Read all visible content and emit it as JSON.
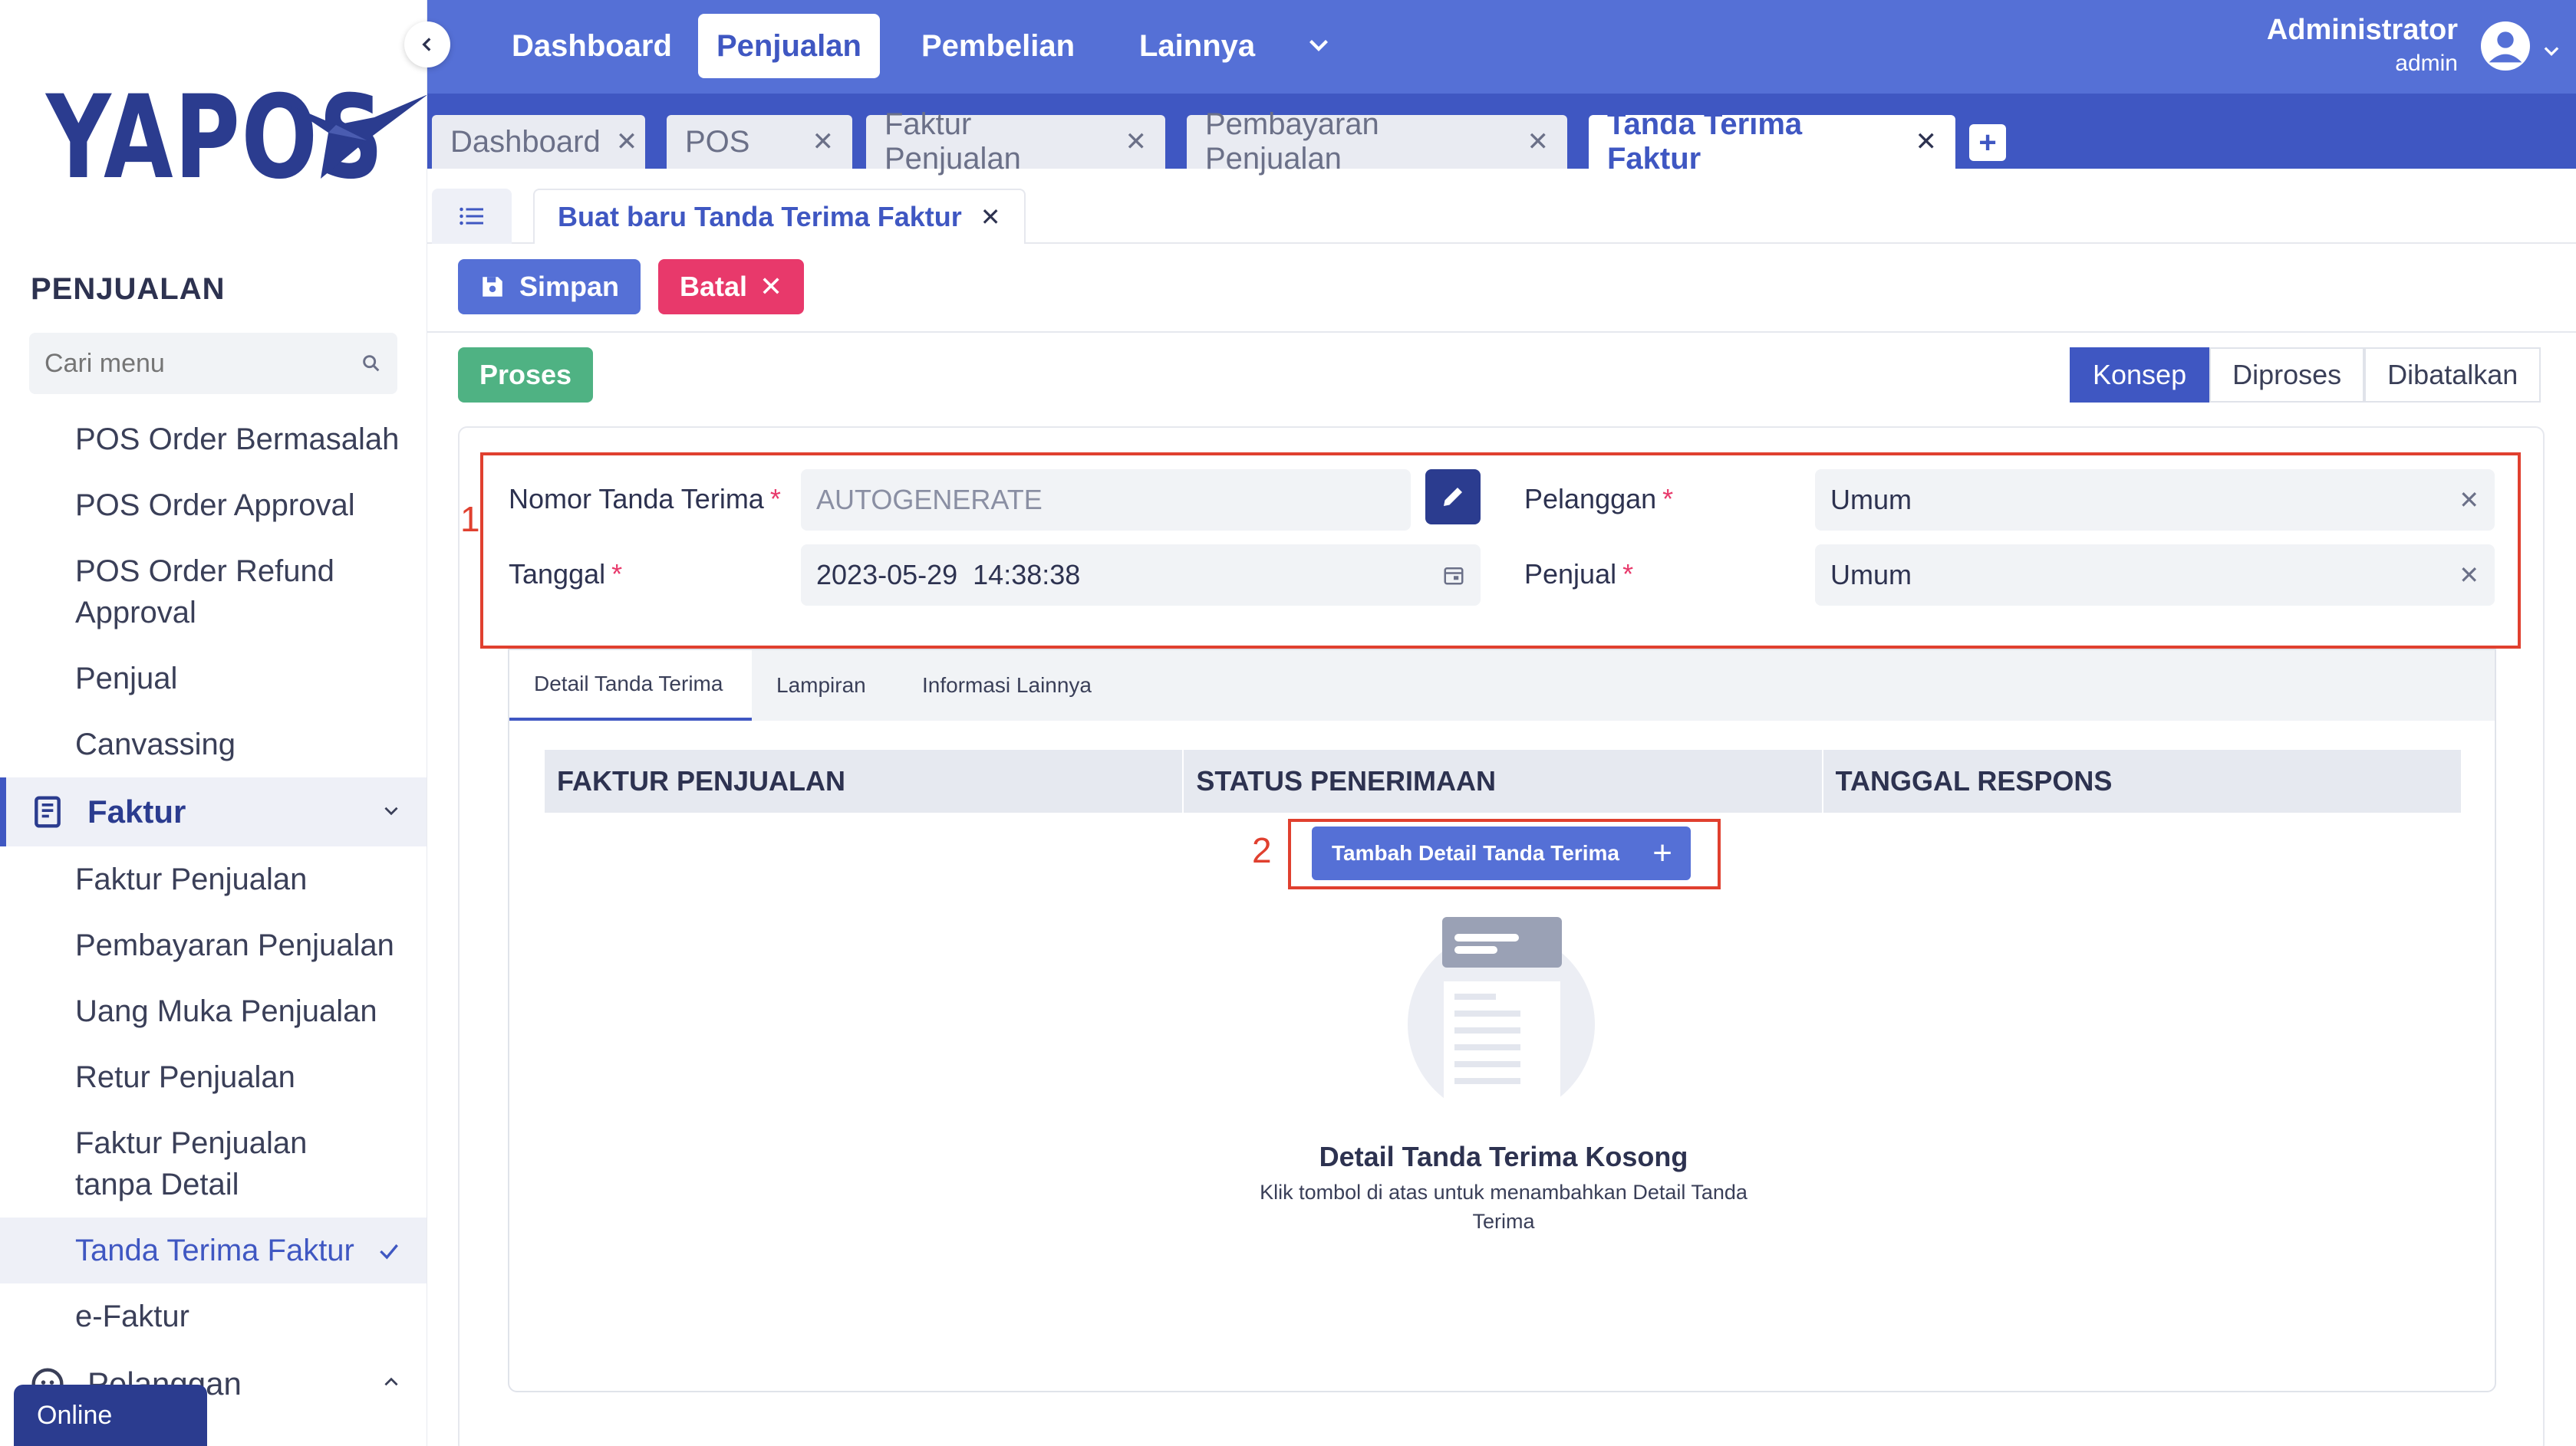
{
  "brand": {
    "name": "YAPOS"
  },
  "colors": {
    "primary": "#3f57c2",
    "nav": "#5570d6",
    "danger": "#e8396b",
    "success": "#4fb283",
    "annotation": "#e0402f"
  },
  "sidebar": {
    "section_title": "PENJUALAN",
    "search_placeholder": "Cari menu",
    "items_top": [
      "POS Order Bermasalah",
      "POS Order Approval",
      "POS Order Refund Approval",
      "Penjual",
      "Canvassing"
    ],
    "group_faktur": "Faktur",
    "items_faktur": [
      "Faktur Penjualan",
      "Pembayaran Penjualan",
      "Uang Muka Penjualan",
      "Retur Penjualan",
      "Faktur Penjualan tanpa Detail",
      "Tanda Terima Faktur",
      "e-Faktur"
    ],
    "group_pelanggan": "Pelanggan",
    "online": "Online"
  },
  "topnav": {
    "items": [
      "Dashboard",
      "Penjualan",
      "Pembelian",
      "Lainnya"
    ],
    "user_name": "Administrator",
    "user_role": "admin"
  },
  "doc_tabs": [
    "Dashboard",
    "POS",
    "Faktur Penjualan",
    "Pembayaran Penjualan",
    "Tanda Terima Faktur"
  ],
  "subtab": "Buat baru Tanda Terima Faktur",
  "toolbar": {
    "save": "Simpan",
    "cancel": "Batal",
    "proses": "Proses"
  },
  "status_steps": [
    "Konsep",
    "Diproses",
    "Dibatalkan"
  ],
  "form": {
    "nomor_label": "Nomor Tanda Terima",
    "nomor_value": "AUTOGENERATE",
    "tanggal_label": "Tanggal",
    "tanggal_value": "2023-05-29  14:38:38",
    "pelanggan_label": "Pelanggan",
    "pelanggan_value": "Umum",
    "penjual_label": "Penjual",
    "penjual_value": "Umum"
  },
  "annotations": [
    "1",
    "2"
  ],
  "detail_tabs": [
    "Detail Tanda Terima",
    "Lampiran",
    "Informasi Lainnya"
  ],
  "table": {
    "columns": [
      "FAKTUR PENJUALAN",
      "STATUS PENERIMAAN",
      "TANGGAL RESPONS"
    ]
  },
  "add_detail": "Tambah Detail Tanda Terima",
  "empty": {
    "title": "Detail Tanda Terima Kosong",
    "subtitle": "Klik tombol di atas untuk menambahkan Detail Tanda Terima"
  }
}
